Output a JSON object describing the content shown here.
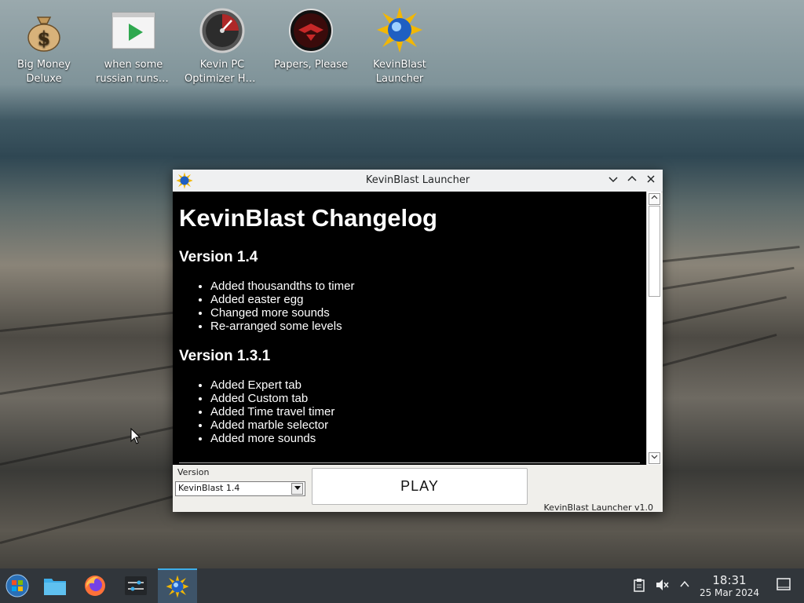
{
  "desktop": {
    "icons": [
      {
        "label_line1": "Big Money",
        "label_line2": "Deluxe"
      },
      {
        "label_line1": "when some",
        "label_line2": "russian runs a..."
      },
      {
        "label_line1": "Kevin PC",
        "label_line2": "Optimizer Ho..."
      },
      {
        "label_line1": "Papers, Please",
        "label_line2": ""
      },
      {
        "label_line1": "KevinBlast",
        "label_line2": "Launcher"
      }
    ]
  },
  "window": {
    "title": "KevinBlast Launcher",
    "changelog": {
      "heading": "KevinBlast Changelog",
      "versions": [
        {
          "name": "Version 1.4",
          "items": [
            "Added thousandths to timer",
            "Added easter egg",
            "Changed more sounds",
            "Re-arranged some levels"
          ]
        },
        {
          "name": "Version 1.3.1",
          "items": [
            "Added Expert tab",
            "Added Custom tab",
            "Added Time travel timer",
            "Added marble selector",
            "Added more sounds"
          ]
        }
      ]
    },
    "version_label": "Version",
    "version_selected": "KevinBlast 1.4",
    "play_label": "PLAY",
    "launcher_version": "KevinBlast Launcher v1.0"
  },
  "taskbar": {
    "time": "18:31",
    "date": "25 Mar 2024"
  }
}
